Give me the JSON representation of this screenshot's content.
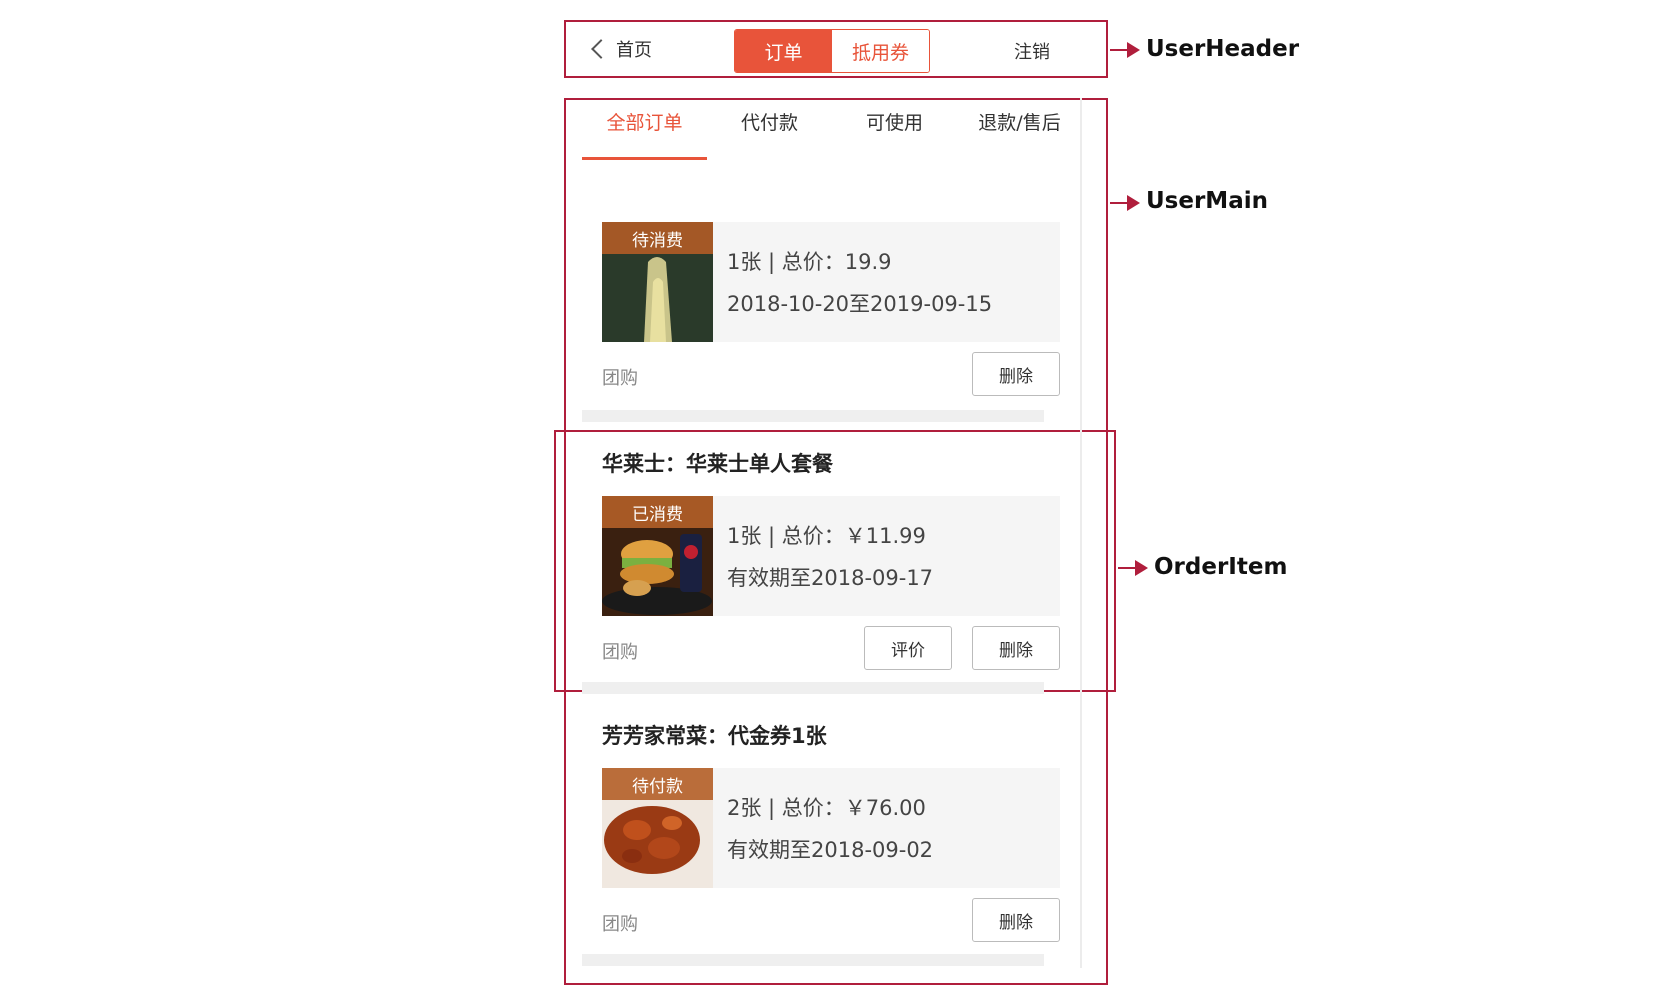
{
  "header": {
    "back_label": "首页",
    "seg_orders": "订单",
    "seg_coupons": "抵用券",
    "logout": "注销"
  },
  "tabs": [
    {
      "label": "全部订单"
    },
    {
      "label": "代付款"
    },
    {
      "label": "可使用"
    },
    {
      "label": "退款/售后"
    }
  ],
  "orders": [
    {
      "title": "",
      "status": "待消费",
      "line1": "1张 | 总价：19.9",
      "line2": "2018-10-20至2019-09-15",
      "type": "团购",
      "delete_label": "删除",
      "image": "drink"
    },
    {
      "title": "华莱士：华莱士单人套餐",
      "status": "已消费",
      "line1": "1张 | 总价：￥11.99",
      "line2": "有效期至2018-09-17",
      "type": "团购",
      "review_label": "评价",
      "delete_label": "删除",
      "image": "burger"
    },
    {
      "title": "芳芳家常菜：代金券1张",
      "status": "待付款",
      "line1": "2张 | 总价：￥76.00",
      "line2": "有效期至2018-09-02",
      "type": "团购",
      "delete_label": "删除",
      "image": "meat"
    }
  ],
  "annotations": {
    "header": "UserHeader",
    "main": "UserMain",
    "item": "OrderItem"
  },
  "colors": {
    "accent": "#e8543a",
    "annotation": "#b01e3c"
  }
}
